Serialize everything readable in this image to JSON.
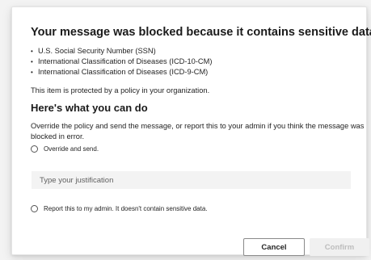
{
  "dialog": {
    "title": "Your message was blocked because it contains sensitive data",
    "sensitive_items": [
      "U.S. Social Security Number (SSN)",
      "International Classification of Diseases (ICD-10-CM)",
      "International Classification of Diseases (ICD-9-CM)"
    ],
    "bullet_char": "•",
    "policy_text": "This item is protected by a policy in your organization.",
    "section_heading": "Here's what you can do",
    "instructions": "Override the policy and send the message, or report this to your admin if you think the message was blocked in error.",
    "options": {
      "override_label": "Override and send.",
      "justification_placeholder": "Type your justification",
      "justification_value": "",
      "report_label": "Report this to my admin. It doesn't contain sensitive data."
    },
    "buttons": {
      "cancel_label": "Cancel",
      "confirm_label": "Confirm"
    }
  },
  "colors": {
    "background": "#f3f3f3",
    "dialog_background": "#ffffff",
    "text": "#242424",
    "disabled_text": "#bdbdbd",
    "input_background": "#f3f3f3"
  }
}
